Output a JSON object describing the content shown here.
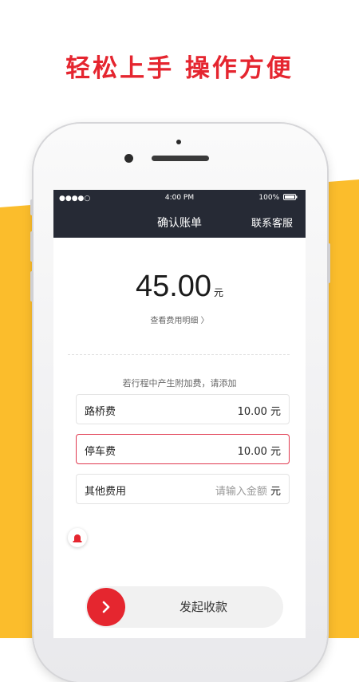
{
  "headline": "轻松上手 操作方便",
  "colors": {
    "accent": "#e5252f",
    "yellow": "#fbbd2c",
    "navbar": "#262a35"
  },
  "statusbar": {
    "signal": "●●●●○",
    "time": "4:00 PM",
    "battery": "100%"
  },
  "nav": {
    "title": "确认账单",
    "service": "联系客服"
  },
  "bill": {
    "amount": "45.00",
    "unit": "元",
    "detail_link": "查看费用明细 〉"
  },
  "extra_fee_hint": "若行程中产生附加费，请添加",
  "fees": [
    {
      "label": "路桥费",
      "value": "10.00 元"
    },
    {
      "label": "停车费",
      "value": "10.00 元"
    },
    {
      "label": "其他费用",
      "placeholder": "请输入金额",
      "unit": "元"
    }
  ],
  "action": {
    "button_label": "发起收款",
    "icon": "chevron-right-icon"
  },
  "alarm_icon": "alarm-light-icon"
}
